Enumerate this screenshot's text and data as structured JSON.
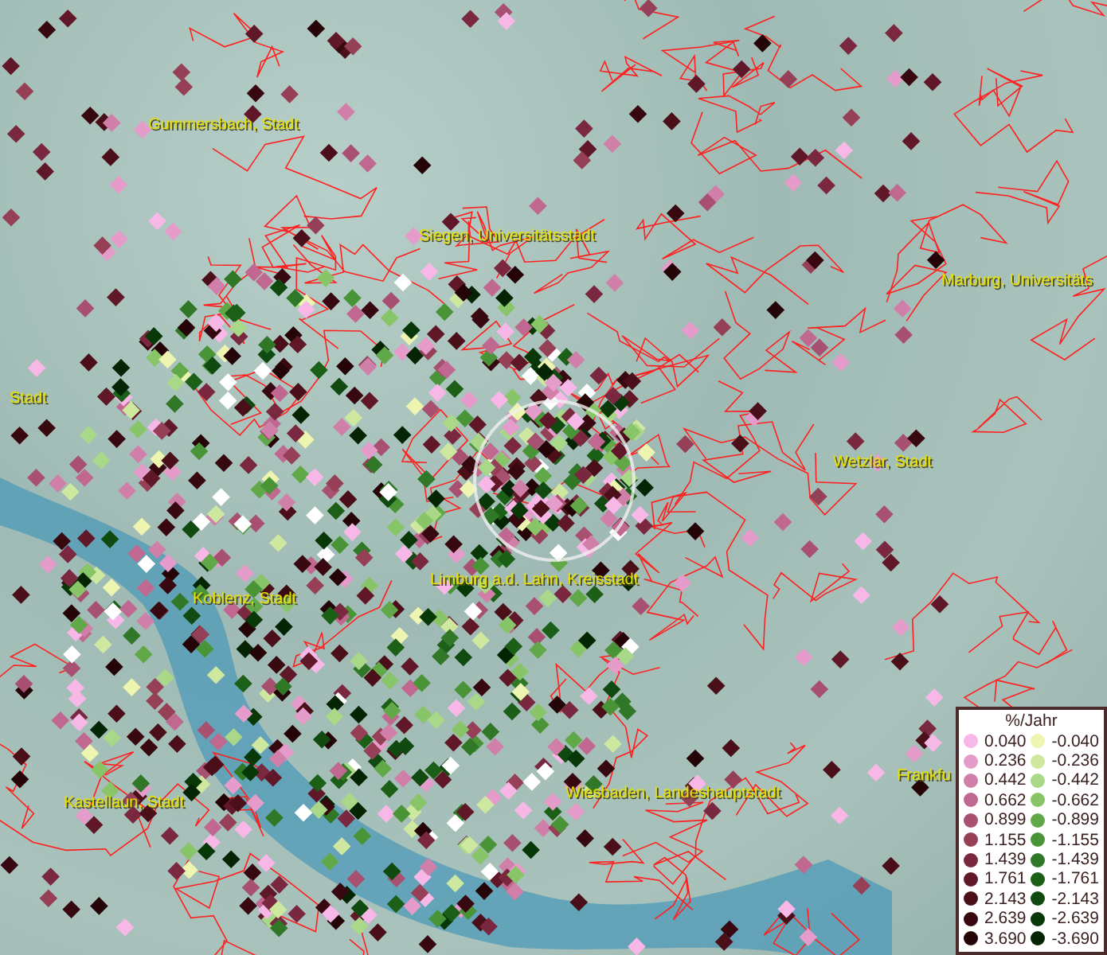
{
  "map": {
    "places": [
      {
        "name": "Gummersbach, Stadt"
      },
      {
        "name": "Siegen, Universitätsstadt"
      },
      {
        "name": "Marburg, Universitäts"
      },
      {
        "name": "Stadt"
      },
      {
        "name": "Wetzlar, Stadt"
      },
      {
        "name": "Koblenz, Stadt"
      },
      {
        "name": "Limburg a.d. Lahn, Kreisstadt"
      },
      {
        "name": "Kastellaun, Stadt"
      },
      {
        "name": "Wiesbaden, Landeshauptstadt"
      },
      {
        "name": "Frankfu"
      }
    ]
  },
  "legend": {
    "title": "%/Jahr",
    "rows": [
      {
        "positive": {
          "label": "0.040",
          "color": "#f7b8e8"
        },
        "negative": {
          "label": "-0.040",
          "color": "#eef5b0"
        }
      },
      {
        "positive": {
          "label": "0.236",
          "color": "#e59ccb"
        },
        "negative": {
          "label": "-0.236",
          "color": "#cfe8a0"
        }
      },
      {
        "positive": {
          "label": "0.442",
          "color": "#d080a8"
        },
        "negative": {
          "label": "-0.442",
          "color": "#a8d888"
        }
      },
      {
        "positive": {
          "label": "0.662",
          "color": "#c06890"
        },
        "negative": {
          "label": "-0.662",
          "color": "#88c468"
        }
      },
      {
        "positive": {
          "label": "0.899",
          "color": "#a85070"
        },
        "negative": {
          "label": "-0.899",
          "color": "#60a848"
        }
      },
      {
        "positive": {
          "label": "1.155",
          "color": "#964058"
        },
        "negative": {
          "label": "-1.155",
          "color": "#4a9438"
        }
      },
      {
        "positive": {
          "label": "1.439",
          "color": "#7a2840"
        },
        "negative": {
          "label": "-1.439",
          "color": "#307828"
        }
      },
      {
        "positive": {
          "label": "1.761",
          "color": "#601828"
        },
        "negative": {
          "label": "-1.761",
          "color": "#1c6018"
        }
      },
      {
        "positive": {
          "label": "2.143",
          "color": "#4a0f18"
        },
        "negative": {
          "label": "-2.143",
          "color": "#104a10"
        }
      },
      {
        "positive": {
          "label": "2.639",
          "color": "#380810"
        },
        "negative": {
          "label": "-2.639",
          "color": "#083808"
        }
      },
      {
        "positive": {
          "label": "3.690",
          "color": "#250408"
        },
        "negative": {
          "label": "-3.690",
          "color": "#042404"
        }
      }
    ]
  }
}
